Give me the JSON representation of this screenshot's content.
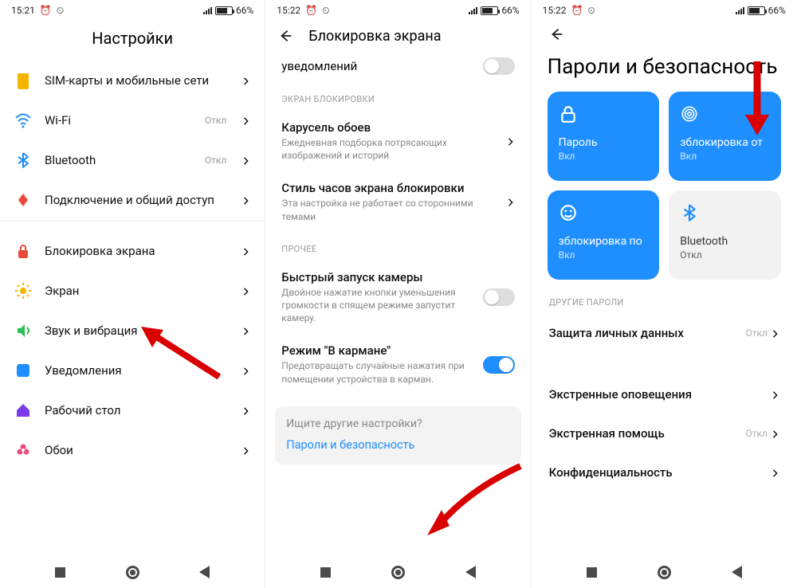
{
  "status": {
    "time1": "15:21",
    "time2": "15:22",
    "time3": "15:22",
    "battery": "66%"
  },
  "panel1": {
    "title": "Настройки",
    "rows": [
      {
        "label": "SIM-карты и мобильные сети",
        "value": "",
        "icon": "sim",
        "color": "#f5b400"
      },
      {
        "label": "Wi-Fi",
        "value": "Откл",
        "icon": "wifi",
        "color": "#1f8fff"
      },
      {
        "label": "Bluetooth",
        "value": "Откл",
        "icon": "bt",
        "color": "#1f8fff"
      },
      {
        "label": "Подключение и общий доступ",
        "value": "",
        "icon": "share",
        "color": "#e84b3c"
      }
    ],
    "rows2": [
      {
        "label": "Блокировка экрана",
        "icon": "lock",
        "color": "#e84b3c"
      },
      {
        "label": "Экран",
        "icon": "sun",
        "color": "#f5b400"
      },
      {
        "label": "Звук и вибрация",
        "icon": "sound",
        "color": "#2bbf53"
      },
      {
        "label": "Уведомления",
        "icon": "square",
        "color": "#1f8fff"
      },
      {
        "label": "Рабочий стол",
        "icon": "home",
        "color": "#7a3ce8"
      },
      {
        "label": "Обои",
        "icon": "flower",
        "color": "#e84b7c"
      }
    ]
  },
  "panel2": {
    "title": "Блокировка экрана",
    "topcut": "уведомлений",
    "s1": "ЭКРАН БЛОКИРОВКИ",
    "carousel_t": "Карусель обоев",
    "carousel_d": "Ежедневная подборка потрясающих изображений и историй",
    "clock_t": "Стиль часов экрана блокировки",
    "clock_d": "Эта настройка не работает со сторонними темами",
    "s2": "ПРОЧЕЕ",
    "cam_t": "Быстрый запуск камеры",
    "cam_d": "Двойное нажатие кнопки уменьшения громкости в спящем режиме запустит камеру.",
    "pocket_t": "Режим \"В кармане\"",
    "pocket_d": "Предотвращать случайные нажатия при помещении устройства в карман.",
    "hint": "Ищите другие настройки?",
    "link": "Пароли и безопасность"
  },
  "panel3": {
    "title": "Пароли и безопасность",
    "tiles": [
      {
        "title": "Пароль",
        "state": "Вкл",
        "kind": "blue",
        "icon": "padlock"
      },
      {
        "title": "зблокировка от",
        "state": "Вкл",
        "kind": "blue",
        "icon": "fprint"
      },
      {
        "title": "зблокировка по",
        "state": "Вкл",
        "kind": "blue",
        "icon": "face"
      },
      {
        "title": "Bluetooth",
        "state": "Откл",
        "kind": "grey",
        "icon": "bt"
      }
    ],
    "s1": "ДРУГИЕ ПАРОЛИ",
    "rows": [
      {
        "label": "Защита личных данных",
        "value": "Откл"
      },
      {
        "label": "Экстренные оповещения",
        "value": ""
      },
      {
        "label": "Экстренная помощь",
        "value": "Откл"
      },
      {
        "label": "Конфиденциальность",
        "value": ""
      }
    ]
  }
}
